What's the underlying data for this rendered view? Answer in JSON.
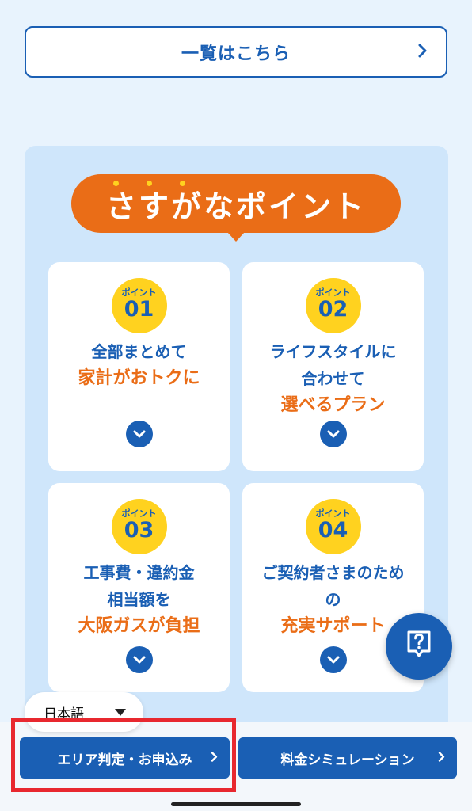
{
  "list_button": {
    "label": "一覧はこちら"
  },
  "points": {
    "banner_title": "さすがなポイント",
    "cards": [
      {
        "badge_small": "ポイント",
        "badge_num": "01",
        "line1": "全部まとめて",
        "line2": "",
        "highlight": "家計がおトクに"
      },
      {
        "badge_small": "ポイント",
        "badge_num": "02",
        "line1": "ライフスタイルに",
        "line2": "合わせて",
        "highlight": "選べるプラン"
      },
      {
        "badge_small": "ポイント",
        "badge_num": "03",
        "line1": "工事費・違約金",
        "line2": "相当額を",
        "highlight": "大阪ガスが負担"
      },
      {
        "badge_small": "ポイント",
        "badge_num": "04",
        "line1": "ご契約者さまのため",
        "line2": "の",
        "highlight": "充実サポート"
      }
    ]
  },
  "language": {
    "selected": "日本語"
  },
  "bottom_bar": {
    "area_button": "エリア判定・お申込み",
    "simulation_button": "料金シミュレーション"
  },
  "icons": {
    "chevron": "chevron-right-icon",
    "expand": "chevron-down-circle-icon",
    "help": "question-bubble-icon"
  },
  "colors": {
    "brand_blue": "#1a5fb4",
    "accent_orange": "#ea6d17",
    "badge_yellow": "#ffd21f",
    "highlight_red": "#e8282f"
  }
}
